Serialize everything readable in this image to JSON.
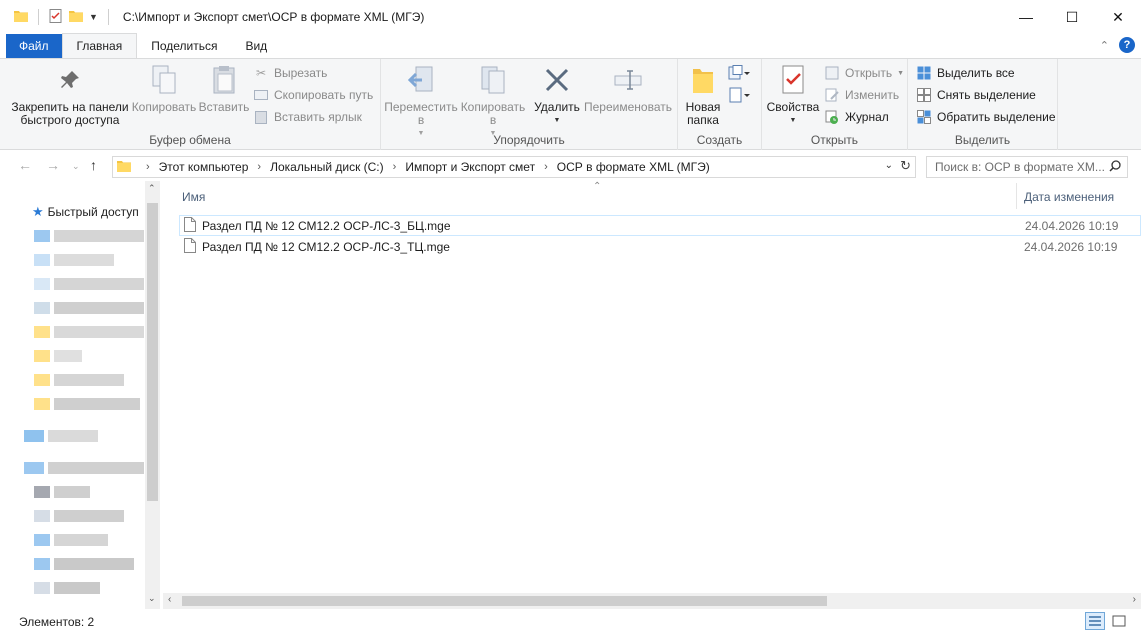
{
  "window": {
    "title": "C:\\Импорт и Экспорт смет\\ОСР в формате XML (МГЭ)",
    "controls": {
      "minimize": "—",
      "maximize": "☐",
      "close": "✕"
    }
  },
  "ribbon_tabs": [
    "Файл",
    "Главная",
    "Поделиться",
    "Вид"
  ],
  "ribbon": {
    "clipboard": {
      "label": "Буфер обмена",
      "pin": "Закрепить на панели быстрого доступа",
      "copy": "Копировать",
      "paste": "Вставить",
      "cut": "Вырезать",
      "copy_path": "Скопировать путь",
      "paste_shortcut": "Вставить ярлык"
    },
    "organize": {
      "label": "Упорядочить",
      "move_to": "Переместить в",
      "copy_to": "Копировать в",
      "delete": "Удалить",
      "rename": "Переименовать"
    },
    "new": {
      "label": "Создать",
      "new_folder": "Новая папка"
    },
    "open": {
      "label": "Открыть",
      "properties": "Свойства",
      "open": "Открыть",
      "edit": "Изменить",
      "history": "Журнал"
    },
    "select": {
      "label": "Выделить",
      "select_all": "Выделить все",
      "select_none": "Снять выделение",
      "invert": "Обратить выделение"
    }
  },
  "address": {
    "crumbs": [
      "Этот компьютер",
      "Локальный диск (C:)",
      "Импорт и Экспорт смет",
      "ОСР в формате XML (МГЭ)"
    ],
    "search_placeholder": "Поиск в: ОСР в формате XM..."
  },
  "nav_pane": {
    "quick_access": "Быстрый доступ"
  },
  "columns": {
    "name": "Имя",
    "date": "Дата изменения"
  },
  "files": [
    {
      "name": "Раздел ПД № 12 СМ12.2 ОСР-ЛС-3_БЦ.mge",
      "date": "24.04.2026 10:19"
    },
    {
      "name": "Раздел ПД № 12 СМ12.2 ОСР-ЛС-3_ТЦ.mge",
      "date": "24.04.2026 10:19"
    }
  ],
  "status": {
    "items": "Элементов: 2"
  },
  "colors": {
    "accent": "#1a66c9",
    "folder": "#f5c542",
    "selection_border": "#cce8ff"
  }
}
